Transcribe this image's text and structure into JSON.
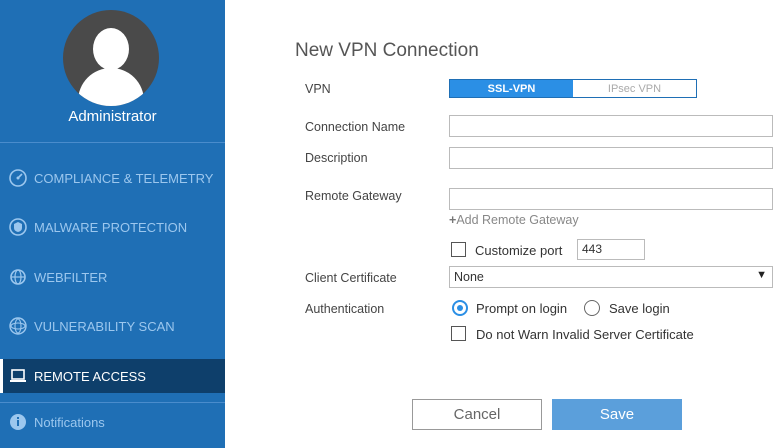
{
  "sidebar": {
    "user_name": "Administrator",
    "items": [
      {
        "label": "COMPLIANCE & TELEMETRY",
        "icon": "speedometer-icon"
      },
      {
        "label": "MALWARE PROTECTION",
        "icon": "shield-icon"
      },
      {
        "label": "WEBFILTER",
        "icon": "globe-icon"
      },
      {
        "label": "VULNERABILITY SCAN",
        "icon": "atom-icon"
      },
      {
        "label": "REMOTE ACCESS",
        "icon": "laptop-icon",
        "active": true
      },
      {
        "label": "Notifications",
        "icon": "info-icon"
      }
    ]
  },
  "form": {
    "title": "New VPN Connection",
    "vpn_label": "VPN",
    "vpn_options": [
      "SSL-VPN",
      "IPsec VPN"
    ],
    "vpn_selected": "SSL-VPN",
    "connection_name_label": "Connection Name",
    "connection_name_value": "",
    "description_label": "Description",
    "description_value": "",
    "remote_gateway_label": "Remote Gateway",
    "remote_gateway_value": "",
    "add_remote_gateway": "Add Remote Gateway",
    "customize_port_label": "Customize port",
    "customize_port_checked": false,
    "port_value": "443",
    "client_certificate_label": "Client Certificate",
    "client_certificate_value": "None",
    "authentication_label": "Authentication",
    "auth_options": [
      "Prompt on login",
      "Save login"
    ],
    "auth_selected": "Prompt on login",
    "no_warn_label": "Do not Warn Invalid Server Certificate",
    "no_warn_checked": false
  },
  "buttons": {
    "cancel": "Cancel",
    "save": "Save"
  },
  "colors": {
    "sidebar_bg": "#1f6fb5",
    "active_bg": "#0e3f6b",
    "accent": "#2b8fe5",
    "save_button": "#5b9fdb"
  }
}
